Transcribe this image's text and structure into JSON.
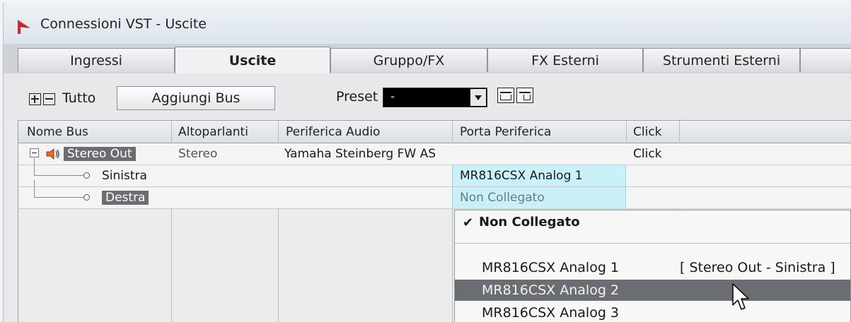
{
  "window": {
    "title": "Connessioni VST - Uscite",
    "icon": "steinberg-logo-icon"
  },
  "tabs": [
    {
      "label": "Ingressi",
      "active": false
    },
    {
      "label": "Uscite",
      "active": true
    },
    {
      "label": "Gruppo/FX",
      "active": false
    },
    {
      "label": "FX Esterni",
      "active": false
    },
    {
      "label": "Strumenti Esterni",
      "active": false
    }
  ],
  "toolbar": {
    "all_label": "Tutto",
    "add_bus_label": "Aggiungi Bus",
    "preset_label": "Preset",
    "preset_value": "-"
  },
  "table": {
    "headers": [
      "Nome Bus",
      "Altoparlanti",
      "Periferica Audio",
      "Porta Periferica",
      "Click"
    ],
    "rows": [
      {
        "name": "Stereo Out",
        "speakers": "Stereo",
        "device": "Yamaha Steinberg FW AS",
        "port": "",
        "click": "Click"
      },
      {
        "name": "Sinistra",
        "speakers": "",
        "device": "",
        "port": "MR816CSX Analog 1",
        "click": ""
      },
      {
        "name": "Destra",
        "speakers": "",
        "device": "",
        "port": "Non Collegato",
        "click": ""
      }
    ]
  },
  "dropdown": {
    "items": [
      {
        "label": "Non Collegato",
        "checked": true,
        "assigned": "",
        "highlighted": false
      },
      {
        "label": "MR816CSX Analog 1",
        "checked": false,
        "assigned": "[ Stereo Out - Sinistra ]",
        "highlighted": false
      },
      {
        "label": "MR816CSX Analog 2",
        "checked": false,
        "assigned": "",
        "highlighted": true
      },
      {
        "label": "MR816CSX Analog 3",
        "checked": false,
        "assigned": "",
        "highlighted": false
      }
    ]
  },
  "colors": {
    "accent_cyan": "#c9f1f7",
    "highlight": "#6a6e73",
    "logo": "#d4282d"
  }
}
